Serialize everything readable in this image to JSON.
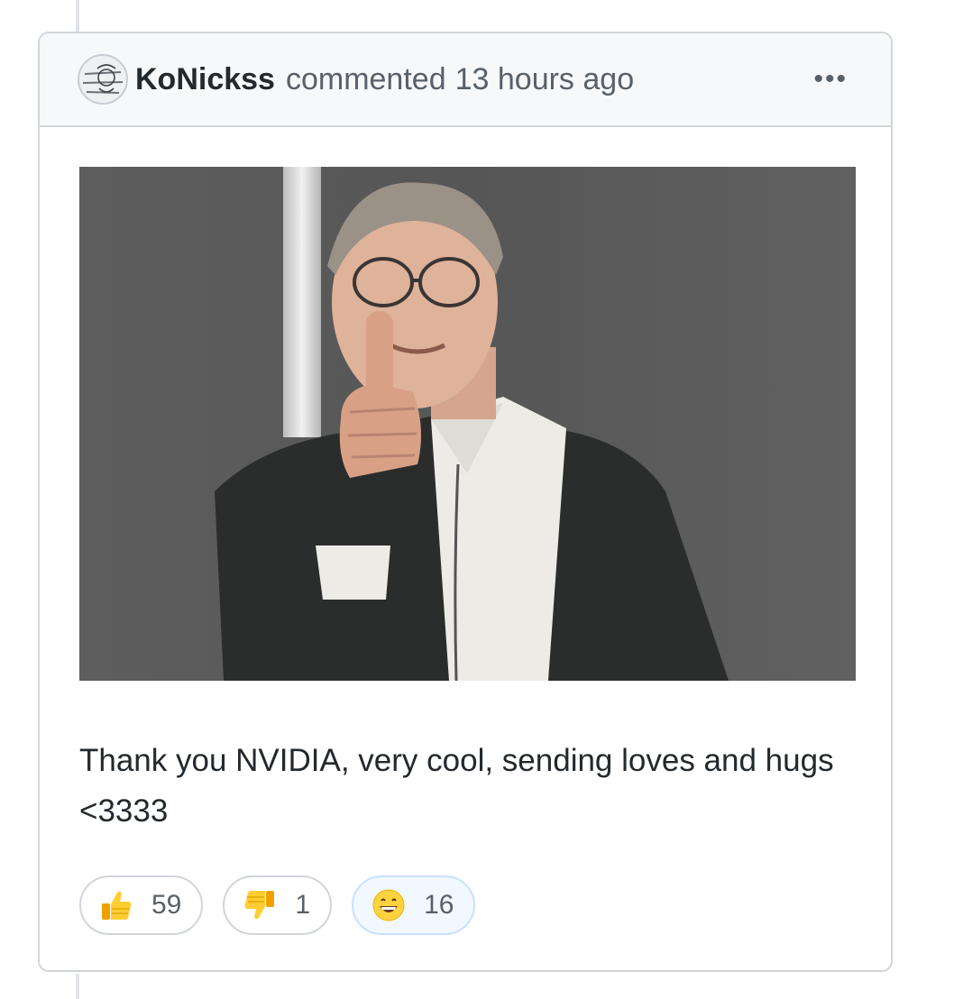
{
  "comment": {
    "author": "KoNickss",
    "action": "commented",
    "timestamp": "13 hours ago",
    "menu_icon": "kebab-horizontal-icon",
    "body_text": "Thank you NVIDIA, very cool, sending loves and hugs <3333",
    "attachment": {
      "type": "photo"
    }
  },
  "reactions": [
    {
      "icon": "thumbs-up-icon",
      "count": "59",
      "active": false
    },
    {
      "icon": "thumbs-down-icon",
      "count": "1",
      "active": false
    },
    {
      "icon": "smile-icon",
      "count": "16",
      "active": true
    }
  ],
  "colors": {
    "border": "#d1d5da",
    "header_bg": "#f6f8fa",
    "text": "#24292e",
    "muted": "#586069",
    "reaction_active_bg": "#f1f8ff",
    "reaction_active_border": "#c8e1ff"
  }
}
